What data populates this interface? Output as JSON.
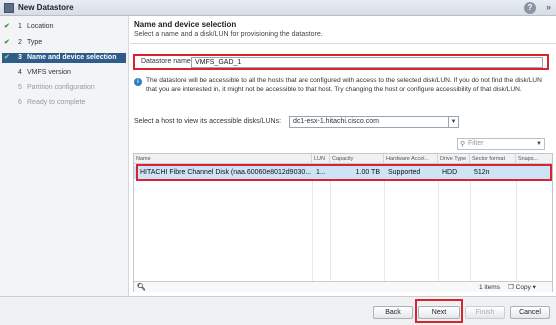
{
  "window": {
    "title": "New Datastore",
    "help_label": "?",
    "expand_label": "»"
  },
  "steps": [
    {
      "num": "1",
      "label": "Location",
      "state": "done"
    },
    {
      "num": "2",
      "label": "Type",
      "state": "done"
    },
    {
      "num": "3",
      "label": "Name and device selection",
      "state": "active"
    },
    {
      "num": "4",
      "label": "VMFS version",
      "state": "next"
    },
    {
      "num": "5",
      "label": "Partition configuration",
      "state": "pending"
    },
    {
      "num": "6",
      "label": "Ready to complete",
      "state": "pending"
    }
  ],
  "main": {
    "heading": "Name and device selection",
    "subheading": "Select a name and a disk/LUN for provisioning the datastore.",
    "name_label": "Datastore name:",
    "name_value": "VMFS_GAD_1",
    "info_text": "The datastore will be accessible to all the hosts that are configured with access to the selected disk/LUN. If you do not find the disk/LUN that you are interested in, it might not be accessible to that host. Try changing the host or configure accessibility of that disk/LUN.",
    "host_label": "Select a host to view its accessible disks/LUNs:",
    "host_value": "dc1-esx-1.hitachi.cisco.com",
    "filter_placeholder": "Filter"
  },
  "table": {
    "columns": [
      "Name",
      "LUN",
      "Capacity",
      "Hardware Accel...",
      "Drive Type",
      "Sector format",
      "Snaps..."
    ],
    "rows": [
      {
        "name": "HITACHI Fibre Channel Disk (naa.60060e8012d9030...",
        "lun": "1...",
        "capacity": "1.00 TB",
        "hw_accel": "Supported",
        "drive_type": "HDD",
        "sector": "512n",
        "snaps": ""
      }
    ],
    "item_count": "1 items",
    "copy_label": "Copy"
  },
  "footer": {
    "back": "Back",
    "next": "Next",
    "finish": "Finish",
    "cancel": "Cancel"
  },
  "colors": {
    "active_step": "#2f5c8a",
    "highlight": "#d6252f",
    "selected_row": "#cfe3f6",
    "check": "#3a9a3a"
  }
}
